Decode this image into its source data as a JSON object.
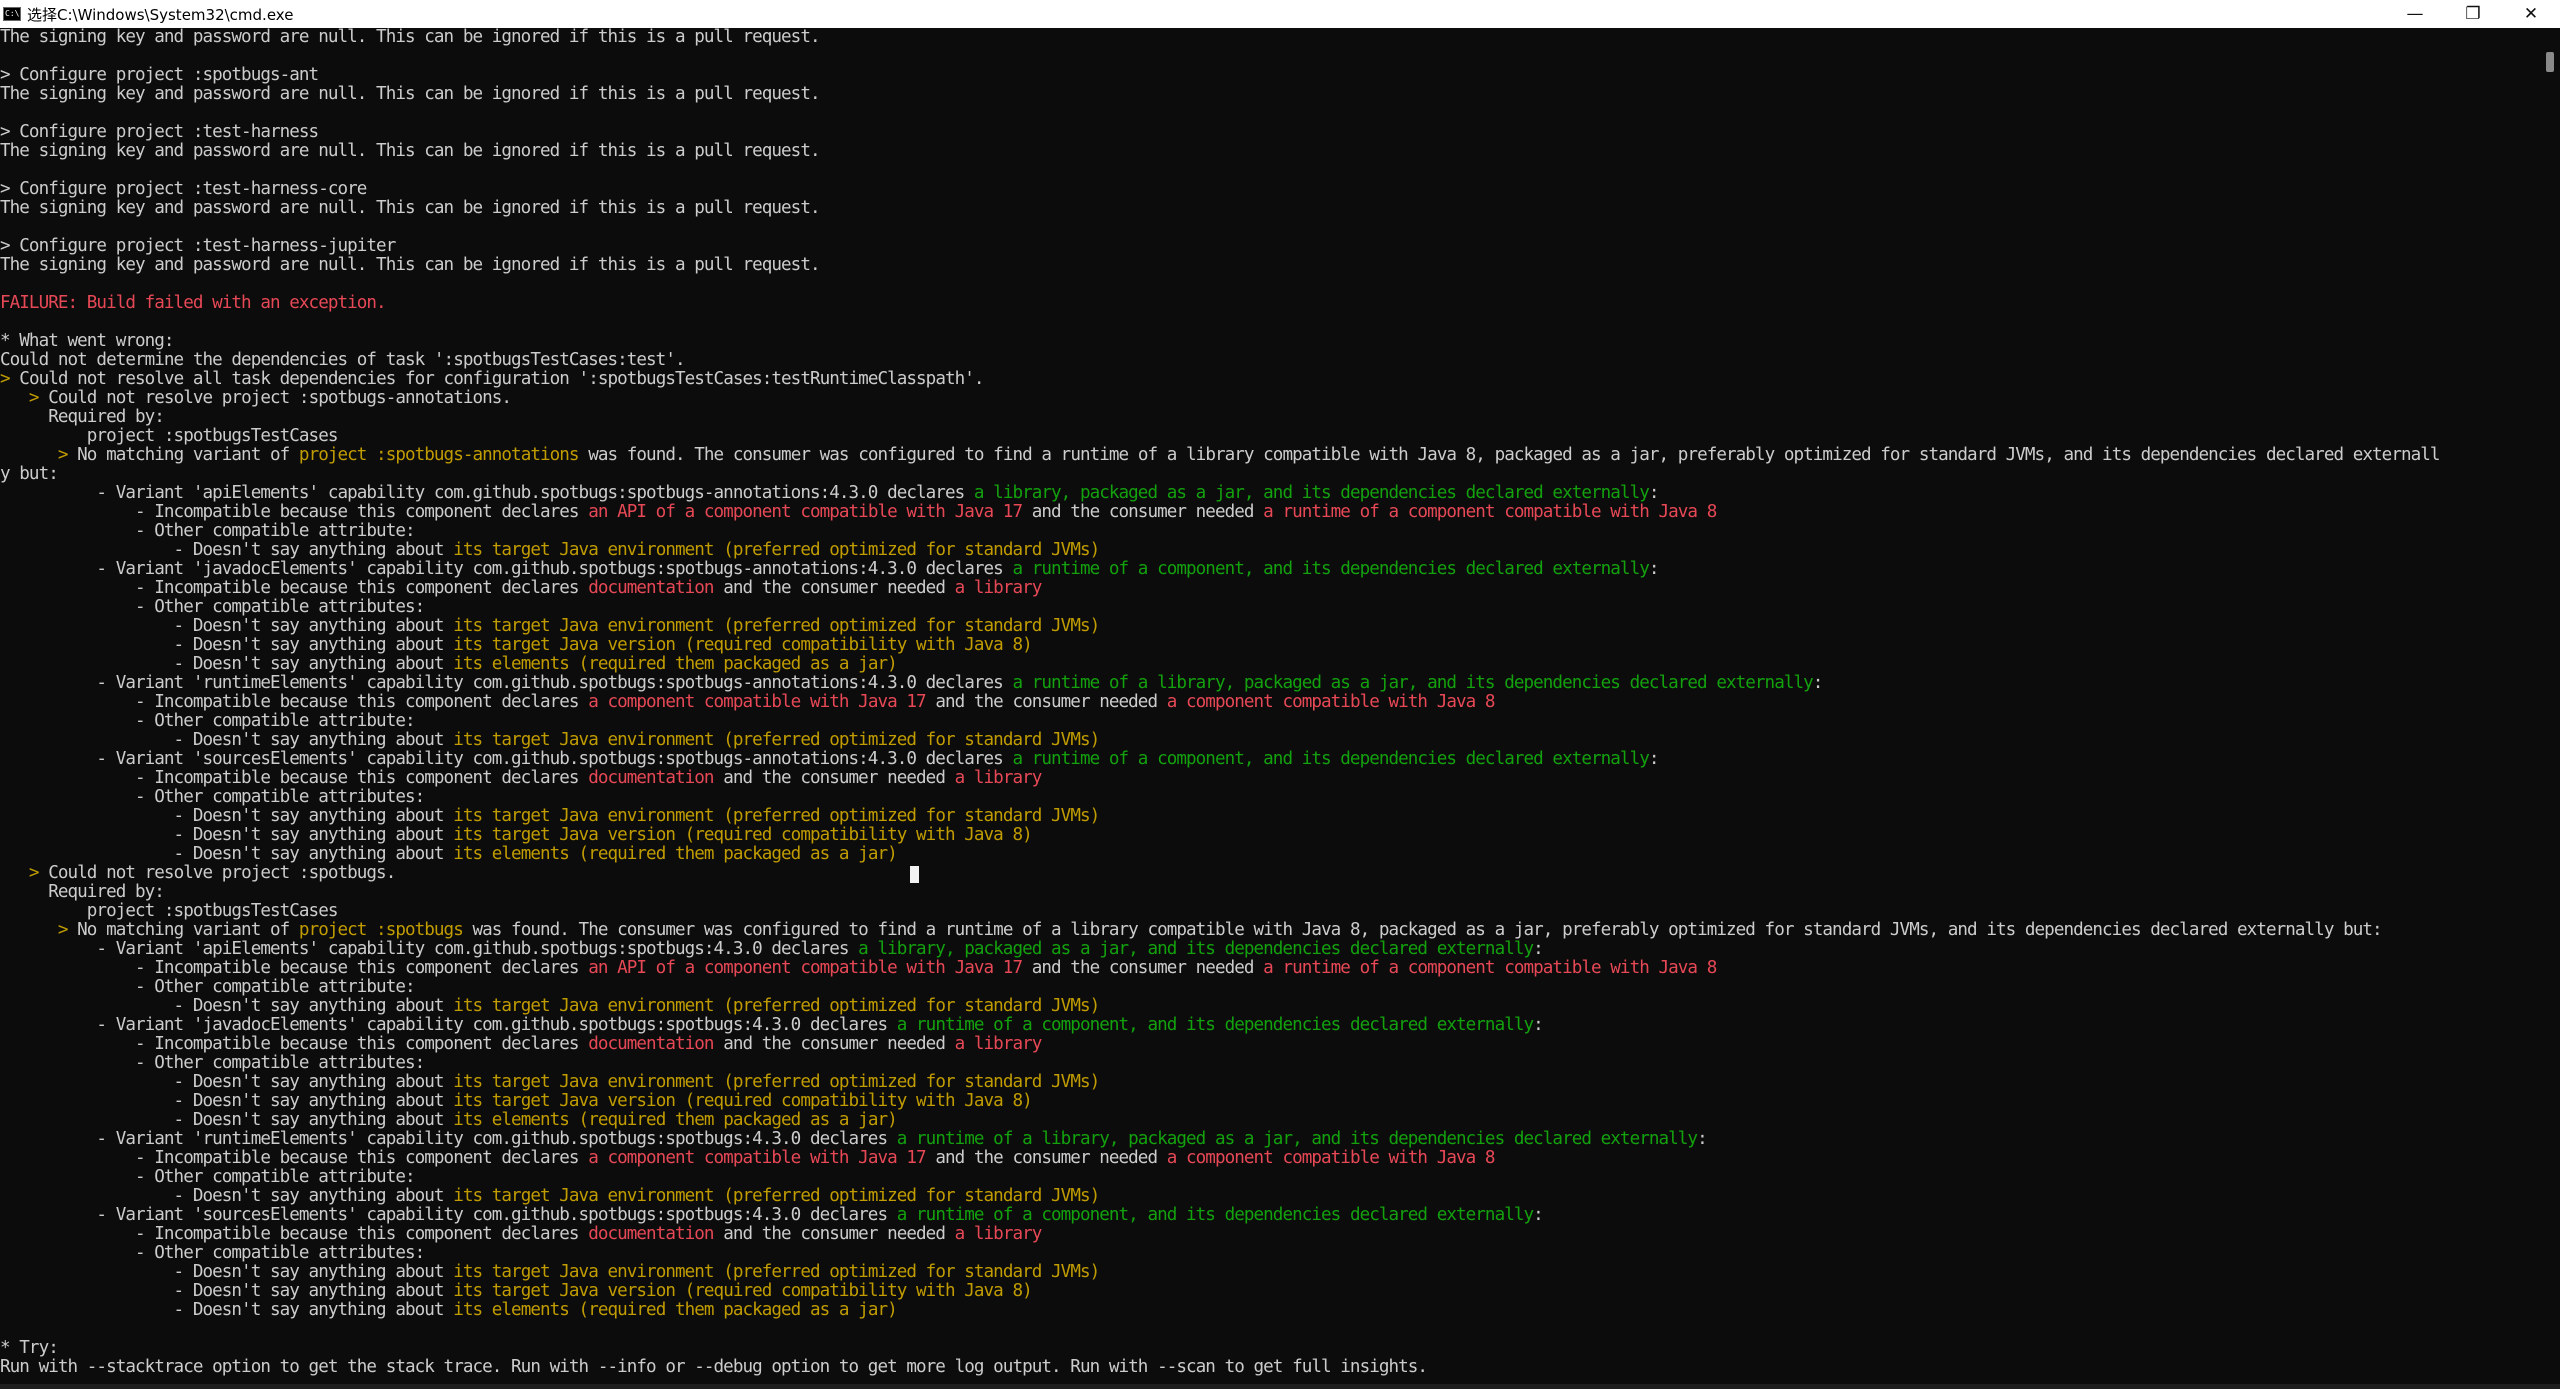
{
  "window": {
    "title": "选择C:\\Windows\\System32\\cmd.exe",
    "icon": "cmd-icon",
    "minimize_glyph": "—",
    "maximize_glyph": "❐",
    "close_glyph": "✕"
  },
  "colors": {
    "background": "#0c0c0c",
    "normal_text": "#cccccc",
    "red": "#e74856",
    "yellow": "#c19c00",
    "green": "#13a10e"
  },
  "terminal": {
    "lines": [
      [
        [
          "The signing key and password are null. This can be ignored if this is a pull request.",
          "normal"
        ]
      ],
      [
        [
          "",
          "normal"
        ]
      ],
      [
        [
          "> Configure project :spotbugs-ant",
          "normal"
        ]
      ],
      [
        [
          "The signing key and password are null. This can be ignored if this is a pull request.",
          "normal"
        ]
      ],
      [
        [
          "",
          "normal"
        ]
      ],
      [
        [
          "> Configure project :test-harness",
          "normal"
        ]
      ],
      [
        [
          "The signing key and password are null. This can be ignored if this is a pull request.",
          "normal"
        ]
      ],
      [
        [
          "",
          "normal"
        ]
      ],
      [
        [
          "> Configure project :test-harness-core",
          "normal"
        ]
      ],
      [
        [
          "The signing key and password are null. This can be ignored if this is a pull request.",
          "normal"
        ]
      ],
      [
        [
          "",
          "normal"
        ]
      ],
      [
        [
          "> Configure project :test-harness-jupiter",
          "normal"
        ]
      ],
      [
        [
          "The signing key and password are null. This can be ignored if this is a pull request.",
          "normal"
        ]
      ],
      [
        [
          "",
          "normal"
        ]
      ],
      [
        [
          "FAILURE: Build failed with an exception.",
          "red"
        ]
      ],
      [
        [
          "",
          "normal"
        ]
      ],
      [
        [
          "* What went wrong:",
          "normal"
        ]
      ],
      [
        [
          "Could not determine the dependencies of task ':spotbugsTestCases:test'.",
          "normal"
        ]
      ],
      [
        [
          ">",
          "yellow"
        ],
        [
          " Could not resolve all task dependencies for configuration ':spotbugsTestCases:testRuntimeClasspath'.",
          "normal"
        ]
      ],
      [
        [
          "   >",
          "yellow"
        ],
        [
          " Could not resolve project :spotbugs-annotations.",
          "normal"
        ]
      ],
      [
        [
          "     Required by:",
          "normal"
        ]
      ],
      [
        [
          "         project :spotbugsTestCases",
          "normal"
        ]
      ],
      [
        [
          "      >",
          "yellow"
        ],
        [
          " No matching variant of ",
          "normal"
        ],
        [
          "project :spotbugs-annotations",
          "yellow"
        ],
        [
          " was found. The consumer was configured to find a runtime of a library compatible with Java 8, packaged as a jar, preferably optimized for standard JVMs, and its dependencies declared externall",
          "normal"
        ]
      ],
      [
        [
          "y but:",
          "normal"
        ]
      ],
      [
        [
          "          - Variant 'apiElements' capability com.github.spotbugs:spotbugs-annotations:4.3.0 declares ",
          "normal"
        ],
        [
          "a library, packaged as a jar, and its dependencies declared externally",
          "green"
        ],
        [
          ":",
          "normal"
        ]
      ],
      [
        [
          "              - Incompatible because this component declares ",
          "normal"
        ],
        [
          "an API of a component compatible with Java 17",
          "red"
        ],
        [
          " and the consumer needed ",
          "normal"
        ],
        [
          "a runtime of a component compatible with Java 8",
          "red"
        ]
      ],
      [
        [
          "              - Other compatible attribute:",
          "normal"
        ]
      ],
      [
        [
          "                  - Doesn't say anything about ",
          "normal"
        ],
        [
          "its target Java environment (preferred optimized for standard JVMs)",
          "yellow"
        ]
      ],
      [
        [
          "          - Variant 'javadocElements' capability com.github.spotbugs:spotbugs-annotations:4.3.0 declares ",
          "normal"
        ],
        [
          "a runtime of a component, and its dependencies declared externally",
          "green"
        ],
        [
          ":",
          "normal"
        ]
      ],
      [
        [
          "              - Incompatible because this component declares ",
          "normal"
        ],
        [
          "documentation",
          "red"
        ],
        [
          " and the consumer needed ",
          "normal"
        ],
        [
          "a library",
          "red"
        ]
      ],
      [
        [
          "              - Other compatible attributes:",
          "normal"
        ]
      ],
      [
        [
          "                  - Doesn't say anything about ",
          "normal"
        ],
        [
          "its target Java environment (preferred optimized for standard JVMs)",
          "yellow"
        ]
      ],
      [
        [
          "                  - Doesn't say anything about ",
          "normal"
        ],
        [
          "its target Java version (required compatibility with Java 8)",
          "yellow"
        ]
      ],
      [
        [
          "                  - Doesn't say anything about ",
          "normal"
        ],
        [
          "its elements (required them packaged as a jar)",
          "yellow"
        ]
      ],
      [
        [
          "          - Variant 'runtimeElements' capability com.github.spotbugs:spotbugs-annotations:4.3.0 declares ",
          "normal"
        ],
        [
          "a runtime of a library, packaged as a jar, and its dependencies declared externally",
          "green"
        ],
        [
          ":",
          "normal"
        ]
      ],
      [
        [
          "              - Incompatible because this component declares ",
          "normal"
        ],
        [
          "a component compatible with Java 17",
          "red"
        ],
        [
          " and the consumer needed ",
          "normal"
        ],
        [
          "a component compatible with Java 8",
          "red"
        ]
      ],
      [
        [
          "              - Other compatible attribute:",
          "normal"
        ]
      ],
      [
        [
          "                  - Doesn't say anything about ",
          "normal"
        ],
        [
          "its target Java environment (preferred optimized for standard JVMs)",
          "yellow"
        ]
      ],
      [
        [
          "          - Variant 'sourcesElements' capability com.github.spotbugs:spotbugs-annotations:4.3.0 declares ",
          "normal"
        ],
        [
          "a runtime of a component, and its dependencies declared externally",
          "green"
        ],
        [
          ":",
          "normal"
        ]
      ],
      [
        [
          "              - Incompatible because this component declares ",
          "normal"
        ],
        [
          "documentation",
          "red"
        ],
        [
          " and the consumer needed ",
          "normal"
        ],
        [
          "a library",
          "red"
        ]
      ],
      [
        [
          "              - Other compatible attributes:",
          "normal"
        ]
      ],
      [
        [
          "                  - Doesn't say anything about ",
          "normal"
        ],
        [
          "its target Java environment (preferred optimized for standard JVMs)",
          "yellow"
        ]
      ],
      [
        [
          "                  - Doesn't say anything about ",
          "normal"
        ],
        [
          "its target Java version (required compatibility with Java 8)",
          "yellow"
        ]
      ],
      [
        [
          "                  - Doesn't say anything about ",
          "normal"
        ],
        [
          "its elements (required them packaged as a jar)",
          "yellow"
        ]
      ],
      [
        [
          "   >",
          "yellow"
        ],
        [
          " Could not resolve project :spotbugs.",
          "normal"
        ]
      ],
      [
        [
          "     Required by:",
          "normal"
        ]
      ],
      [
        [
          "         project :spotbugsTestCases",
          "normal"
        ]
      ],
      [
        [
          "      >",
          "yellow"
        ],
        [
          " No matching variant of ",
          "normal"
        ],
        [
          "project :spotbugs",
          "yellow"
        ],
        [
          " was found. The consumer was configured to find a runtime of a library compatible with Java 8, packaged as a jar, preferably optimized for standard JVMs, and its dependencies declared externally but:",
          "normal"
        ]
      ],
      [
        [
          "          - Variant 'apiElements' capability com.github.spotbugs:spotbugs:4.3.0 declares ",
          "normal"
        ],
        [
          "a library, packaged as a jar, and its dependencies declared externally",
          "green"
        ],
        [
          ":",
          "normal"
        ]
      ],
      [
        [
          "              - Incompatible because this component declares ",
          "normal"
        ],
        [
          "an API of a component compatible with Java 17",
          "red"
        ],
        [
          " and the consumer needed ",
          "normal"
        ],
        [
          "a runtime of a component compatible with Java 8",
          "red"
        ]
      ],
      [
        [
          "              - Other compatible attribute:",
          "normal"
        ]
      ],
      [
        [
          "                  - Doesn't say anything about ",
          "normal"
        ],
        [
          "its target Java environment (preferred optimized for standard JVMs)",
          "yellow"
        ]
      ],
      [
        [
          "          - Variant 'javadocElements' capability com.github.spotbugs:spotbugs:4.3.0 declares ",
          "normal"
        ],
        [
          "a runtime of a component, and its dependencies declared externally",
          "green"
        ],
        [
          ":",
          "normal"
        ]
      ],
      [
        [
          "              - Incompatible because this component declares ",
          "normal"
        ],
        [
          "documentation",
          "red"
        ],
        [
          " and the consumer needed ",
          "normal"
        ],
        [
          "a library",
          "red"
        ]
      ],
      [
        [
          "              - Other compatible attributes:",
          "normal"
        ]
      ],
      [
        [
          "                  - Doesn't say anything about ",
          "normal"
        ],
        [
          "its target Java environment (preferred optimized for standard JVMs)",
          "yellow"
        ]
      ],
      [
        [
          "                  - Doesn't say anything about ",
          "normal"
        ],
        [
          "its target Java version (required compatibility with Java 8)",
          "yellow"
        ]
      ],
      [
        [
          "                  - Doesn't say anything about ",
          "normal"
        ],
        [
          "its elements (required them packaged as a jar)",
          "yellow"
        ]
      ],
      [
        [
          "          - Variant 'runtimeElements' capability com.github.spotbugs:spotbugs:4.3.0 declares ",
          "normal"
        ],
        [
          "a runtime of a library, packaged as a jar, and its dependencies declared externally",
          "green"
        ],
        [
          ":",
          "normal"
        ]
      ],
      [
        [
          "              - Incompatible because this component declares ",
          "normal"
        ],
        [
          "a component compatible with Java 17",
          "red"
        ],
        [
          " and the consumer needed ",
          "normal"
        ],
        [
          "a component compatible with Java 8",
          "red"
        ]
      ],
      [
        [
          "              - Other compatible attribute:",
          "normal"
        ]
      ],
      [
        [
          "                  - Doesn't say anything about ",
          "normal"
        ],
        [
          "its target Java environment (preferred optimized for standard JVMs)",
          "yellow"
        ]
      ],
      [
        [
          "          - Variant 'sourcesElements' capability com.github.spotbugs:spotbugs:4.3.0 declares ",
          "normal"
        ],
        [
          "a runtime of a component, and its dependencies declared externally",
          "green"
        ],
        [
          ":",
          "normal"
        ]
      ],
      [
        [
          "              - Incompatible because this component declares ",
          "normal"
        ],
        [
          "documentation",
          "red"
        ],
        [
          " and the consumer needed ",
          "normal"
        ],
        [
          "a library",
          "red"
        ]
      ],
      [
        [
          "              - Other compatible attributes:",
          "normal"
        ]
      ],
      [
        [
          "                  - Doesn't say anything about ",
          "normal"
        ],
        [
          "its target Java environment (preferred optimized for standard JVMs)",
          "yellow"
        ]
      ],
      [
        [
          "                  - Doesn't say anything about ",
          "normal"
        ],
        [
          "its target Java version (required compatibility with Java 8)",
          "yellow"
        ]
      ],
      [
        [
          "                  - Doesn't say anything about ",
          "normal"
        ],
        [
          "its elements (required them packaged as a jar)",
          "yellow"
        ]
      ],
      [
        [
          "",
          "normal"
        ]
      ],
      [
        [
          "* Try:",
          "normal"
        ]
      ],
      [
        [
          "Run with --stacktrace option to get the stack trace. Run with --info or --debug option to get more log output. Run with --scan to get full insights.",
          "normal"
        ]
      ]
    ]
  }
}
